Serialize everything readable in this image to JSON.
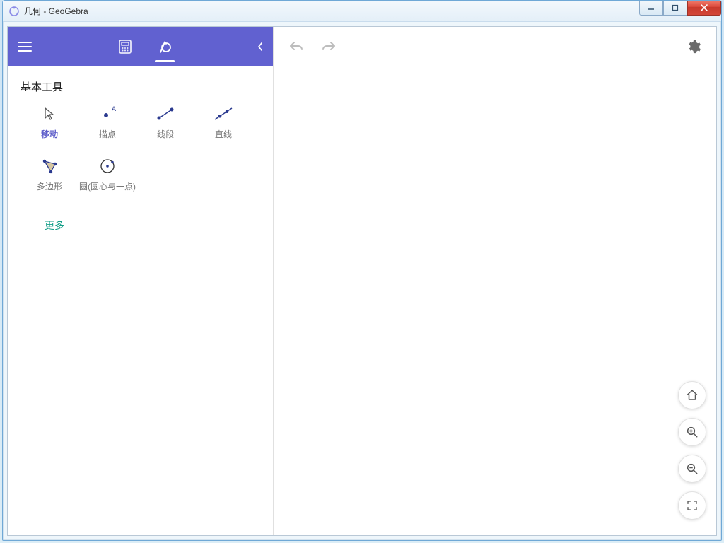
{
  "window": {
    "title": "几何 - GeoGebra"
  },
  "sidebar": {
    "section_title": "基本工具",
    "tools": [
      {
        "label": "移动"
      },
      {
        "label": "描点"
      },
      {
        "label": "线段"
      },
      {
        "label": "直线"
      },
      {
        "label": "多边形"
      },
      {
        "label": "圆(圆心与一点)"
      }
    ],
    "more_label": "更多"
  },
  "colors": {
    "accent": "#6161d0",
    "tool_stroke": "#2b3a8f",
    "more_link": "#139e88"
  }
}
